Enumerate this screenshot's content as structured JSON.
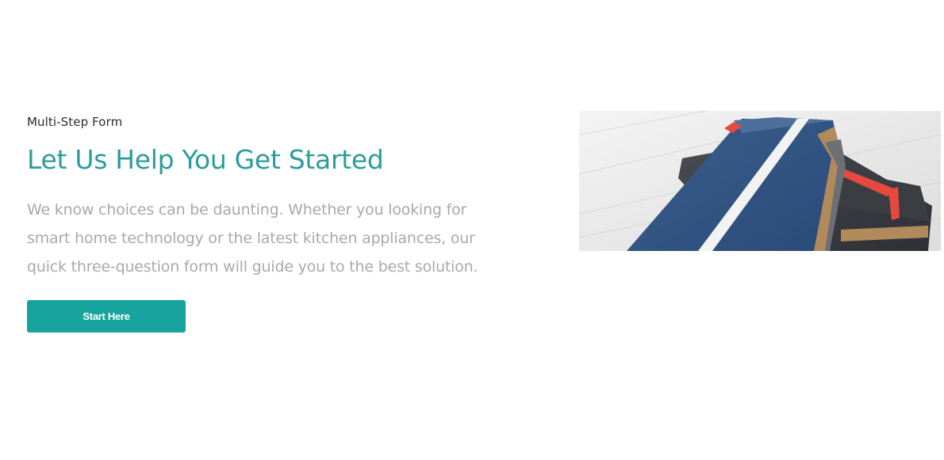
{
  "section": {
    "eyebrow": "Multi-Step Form",
    "headline": "Let Us Help You Get Started",
    "body": "We know choices can be daunting. Whether you looking for smart home technology or the latest kitchen appliances, our quick three-question form will guide you to the best solution.",
    "cta_label": "Start Here"
  },
  "image": {
    "alt": "phone-wallet-cases-photo"
  },
  "colors": {
    "accent": "#2a9d9a",
    "button": "#17a49e",
    "body_text": "#a9a9a6",
    "eyebrow_text": "#2b2b2b"
  }
}
